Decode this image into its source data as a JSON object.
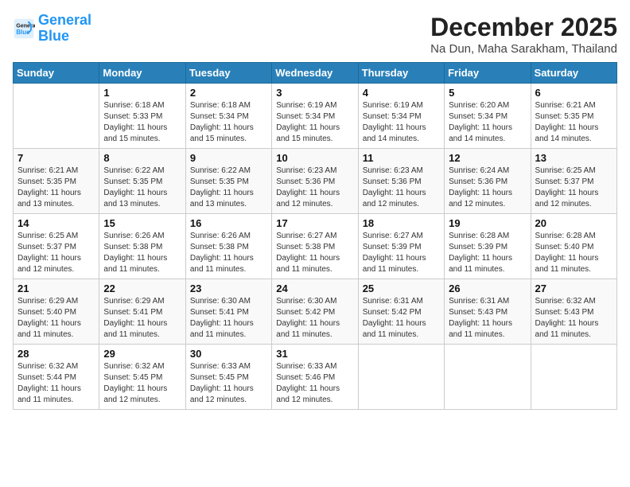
{
  "header": {
    "logo_general": "General",
    "logo_blue": "Blue",
    "month_title": "December 2025",
    "location": "Na Dun, Maha Sarakham, Thailand"
  },
  "weekdays": [
    "Sunday",
    "Monday",
    "Tuesday",
    "Wednesday",
    "Thursday",
    "Friday",
    "Saturday"
  ],
  "weeks": [
    [
      {
        "day": "",
        "info": ""
      },
      {
        "day": "1",
        "info": "Sunrise: 6:18 AM\nSunset: 5:33 PM\nDaylight: 11 hours\nand 15 minutes."
      },
      {
        "day": "2",
        "info": "Sunrise: 6:18 AM\nSunset: 5:34 PM\nDaylight: 11 hours\nand 15 minutes."
      },
      {
        "day": "3",
        "info": "Sunrise: 6:19 AM\nSunset: 5:34 PM\nDaylight: 11 hours\nand 15 minutes."
      },
      {
        "day": "4",
        "info": "Sunrise: 6:19 AM\nSunset: 5:34 PM\nDaylight: 11 hours\nand 14 minutes."
      },
      {
        "day": "5",
        "info": "Sunrise: 6:20 AM\nSunset: 5:34 PM\nDaylight: 11 hours\nand 14 minutes."
      },
      {
        "day": "6",
        "info": "Sunrise: 6:21 AM\nSunset: 5:35 PM\nDaylight: 11 hours\nand 14 minutes."
      }
    ],
    [
      {
        "day": "7",
        "info": "Sunrise: 6:21 AM\nSunset: 5:35 PM\nDaylight: 11 hours\nand 13 minutes."
      },
      {
        "day": "8",
        "info": "Sunrise: 6:22 AM\nSunset: 5:35 PM\nDaylight: 11 hours\nand 13 minutes."
      },
      {
        "day": "9",
        "info": "Sunrise: 6:22 AM\nSunset: 5:35 PM\nDaylight: 11 hours\nand 13 minutes."
      },
      {
        "day": "10",
        "info": "Sunrise: 6:23 AM\nSunset: 5:36 PM\nDaylight: 11 hours\nand 12 minutes."
      },
      {
        "day": "11",
        "info": "Sunrise: 6:23 AM\nSunset: 5:36 PM\nDaylight: 11 hours\nand 12 minutes."
      },
      {
        "day": "12",
        "info": "Sunrise: 6:24 AM\nSunset: 5:36 PM\nDaylight: 11 hours\nand 12 minutes."
      },
      {
        "day": "13",
        "info": "Sunrise: 6:25 AM\nSunset: 5:37 PM\nDaylight: 11 hours\nand 12 minutes."
      }
    ],
    [
      {
        "day": "14",
        "info": "Sunrise: 6:25 AM\nSunset: 5:37 PM\nDaylight: 11 hours\nand 12 minutes."
      },
      {
        "day": "15",
        "info": "Sunrise: 6:26 AM\nSunset: 5:38 PM\nDaylight: 11 hours\nand 11 minutes."
      },
      {
        "day": "16",
        "info": "Sunrise: 6:26 AM\nSunset: 5:38 PM\nDaylight: 11 hours\nand 11 minutes."
      },
      {
        "day": "17",
        "info": "Sunrise: 6:27 AM\nSunset: 5:38 PM\nDaylight: 11 hours\nand 11 minutes."
      },
      {
        "day": "18",
        "info": "Sunrise: 6:27 AM\nSunset: 5:39 PM\nDaylight: 11 hours\nand 11 minutes."
      },
      {
        "day": "19",
        "info": "Sunrise: 6:28 AM\nSunset: 5:39 PM\nDaylight: 11 hours\nand 11 minutes."
      },
      {
        "day": "20",
        "info": "Sunrise: 6:28 AM\nSunset: 5:40 PM\nDaylight: 11 hours\nand 11 minutes."
      }
    ],
    [
      {
        "day": "21",
        "info": "Sunrise: 6:29 AM\nSunset: 5:40 PM\nDaylight: 11 hours\nand 11 minutes."
      },
      {
        "day": "22",
        "info": "Sunrise: 6:29 AM\nSunset: 5:41 PM\nDaylight: 11 hours\nand 11 minutes."
      },
      {
        "day": "23",
        "info": "Sunrise: 6:30 AM\nSunset: 5:41 PM\nDaylight: 11 hours\nand 11 minutes."
      },
      {
        "day": "24",
        "info": "Sunrise: 6:30 AM\nSunset: 5:42 PM\nDaylight: 11 hours\nand 11 minutes."
      },
      {
        "day": "25",
        "info": "Sunrise: 6:31 AM\nSunset: 5:42 PM\nDaylight: 11 hours\nand 11 minutes."
      },
      {
        "day": "26",
        "info": "Sunrise: 6:31 AM\nSunset: 5:43 PM\nDaylight: 11 hours\nand 11 minutes."
      },
      {
        "day": "27",
        "info": "Sunrise: 6:32 AM\nSunset: 5:43 PM\nDaylight: 11 hours\nand 11 minutes."
      }
    ],
    [
      {
        "day": "28",
        "info": "Sunrise: 6:32 AM\nSunset: 5:44 PM\nDaylight: 11 hours\nand 11 minutes."
      },
      {
        "day": "29",
        "info": "Sunrise: 6:32 AM\nSunset: 5:45 PM\nDaylight: 11 hours\nand 12 minutes."
      },
      {
        "day": "30",
        "info": "Sunrise: 6:33 AM\nSunset: 5:45 PM\nDaylight: 11 hours\nand 12 minutes."
      },
      {
        "day": "31",
        "info": "Sunrise: 6:33 AM\nSunset: 5:46 PM\nDaylight: 11 hours\nand 12 minutes."
      },
      {
        "day": "",
        "info": ""
      },
      {
        "day": "",
        "info": ""
      },
      {
        "day": "",
        "info": ""
      }
    ]
  ]
}
